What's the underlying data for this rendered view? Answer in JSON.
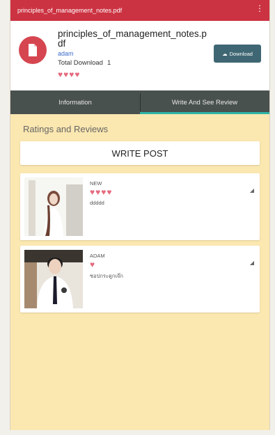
{
  "appbar": {
    "title": "principles_of_management_notes.pdf",
    "menu_icon": "more-vert-icon"
  },
  "file": {
    "title": "principles_of_management_notes.p df",
    "uploader": "adam",
    "downloads_label": "Total Download",
    "downloads_count": "1",
    "rating": 4,
    "download_button": "Download"
  },
  "tabs": [
    {
      "label": "Information",
      "active": false
    },
    {
      "label": "Write And See Review",
      "active": true
    }
  ],
  "reviews_section": {
    "title": "Ratings and Reviews",
    "write_post": "WRITE POST",
    "reviews": [
      {
        "name": "NEW",
        "rating": 4,
        "comment": "ddddd"
      },
      {
        "name": "ADAM",
        "rating": 1,
        "comment": "ซอปกระดูกเจ๊ก"
      }
    ]
  },
  "colors": {
    "appbar": "#cc3342",
    "background": "#fbe7b0",
    "heart": "#e46a7e",
    "tab_indicator": "#2fb4a7"
  }
}
